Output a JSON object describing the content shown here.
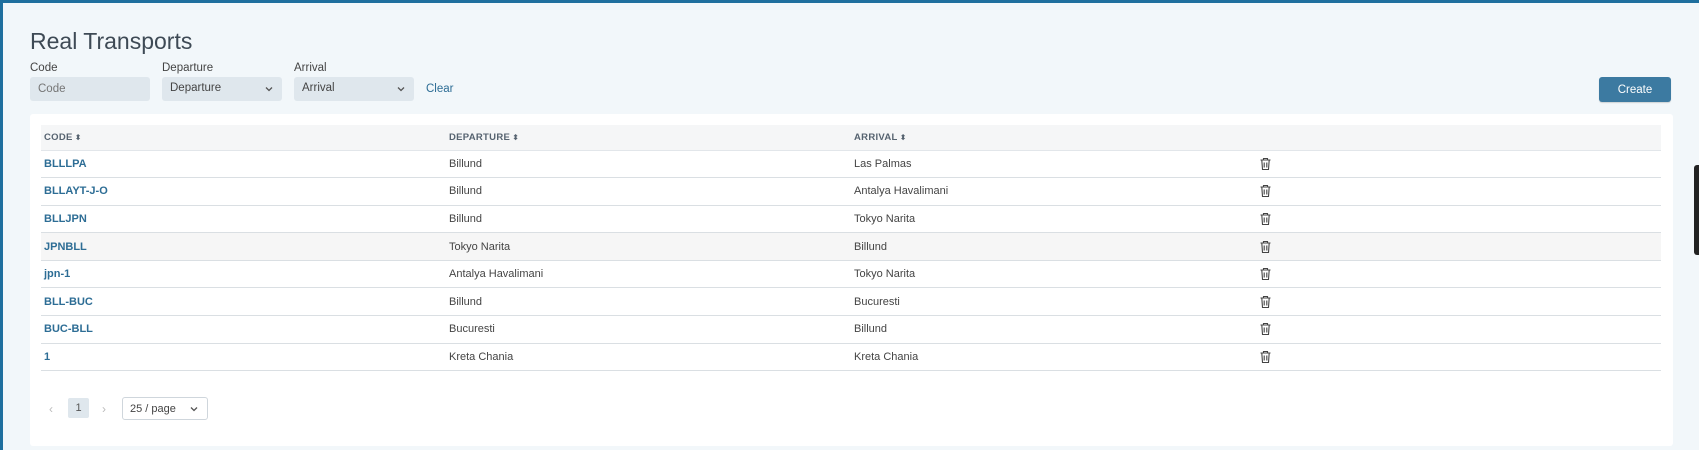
{
  "page": {
    "title": "Real Transports"
  },
  "filters": {
    "code_label": "Code",
    "code_placeholder": "Code",
    "departure_label": "Departure",
    "departure_value": "Departure",
    "arrival_label": "Arrival",
    "arrival_value": "Arrival",
    "clear_label": "Clear"
  },
  "actions": {
    "create_label": "Create"
  },
  "table": {
    "headers": {
      "code": "CODE",
      "departure": "DEPARTURE",
      "arrival": "ARRIVAL"
    },
    "rows": [
      {
        "code": "BLLLPA",
        "departure": "Billund",
        "arrival": "Las Palmas"
      },
      {
        "code": "BLLAYT-J-O",
        "departure": "Billund",
        "arrival": "Antalya Havalimani"
      },
      {
        "code": "BLLJPN",
        "departure": "Billund",
        "arrival": "Tokyo Narita"
      },
      {
        "code": "JPNBLL",
        "departure": "Tokyo Narita",
        "arrival": "Billund"
      },
      {
        "code": "jpn-1",
        "departure": "Antalya Havalimani",
        "arrival": "Tokyo Narita"
      },
      {
        "code": "BLL-BUC",
        "departure": "Billund",
        "arrival": "Bucuresti"
      },
      {
        "code": "BUC-BLL",
        "departure": "Bucuresti",
        "arrival": "Billund"
      },
      {
        "code": "1",
        "departure": "Kreta Chania",
        "arrival": "Kreta Chania"
      }
    ]
  },
  "pagination": {
    "prev": "‹",
    "current_page": "1",
    "next": "›",
    "page_size": "25 / page"
  },
  "colors": {
    "accent": "#3c7aa1",
    "link": "#2d6d95",
    "frame": "#1f6f9e",
    "background": "#f2f7fa"
  }
}
